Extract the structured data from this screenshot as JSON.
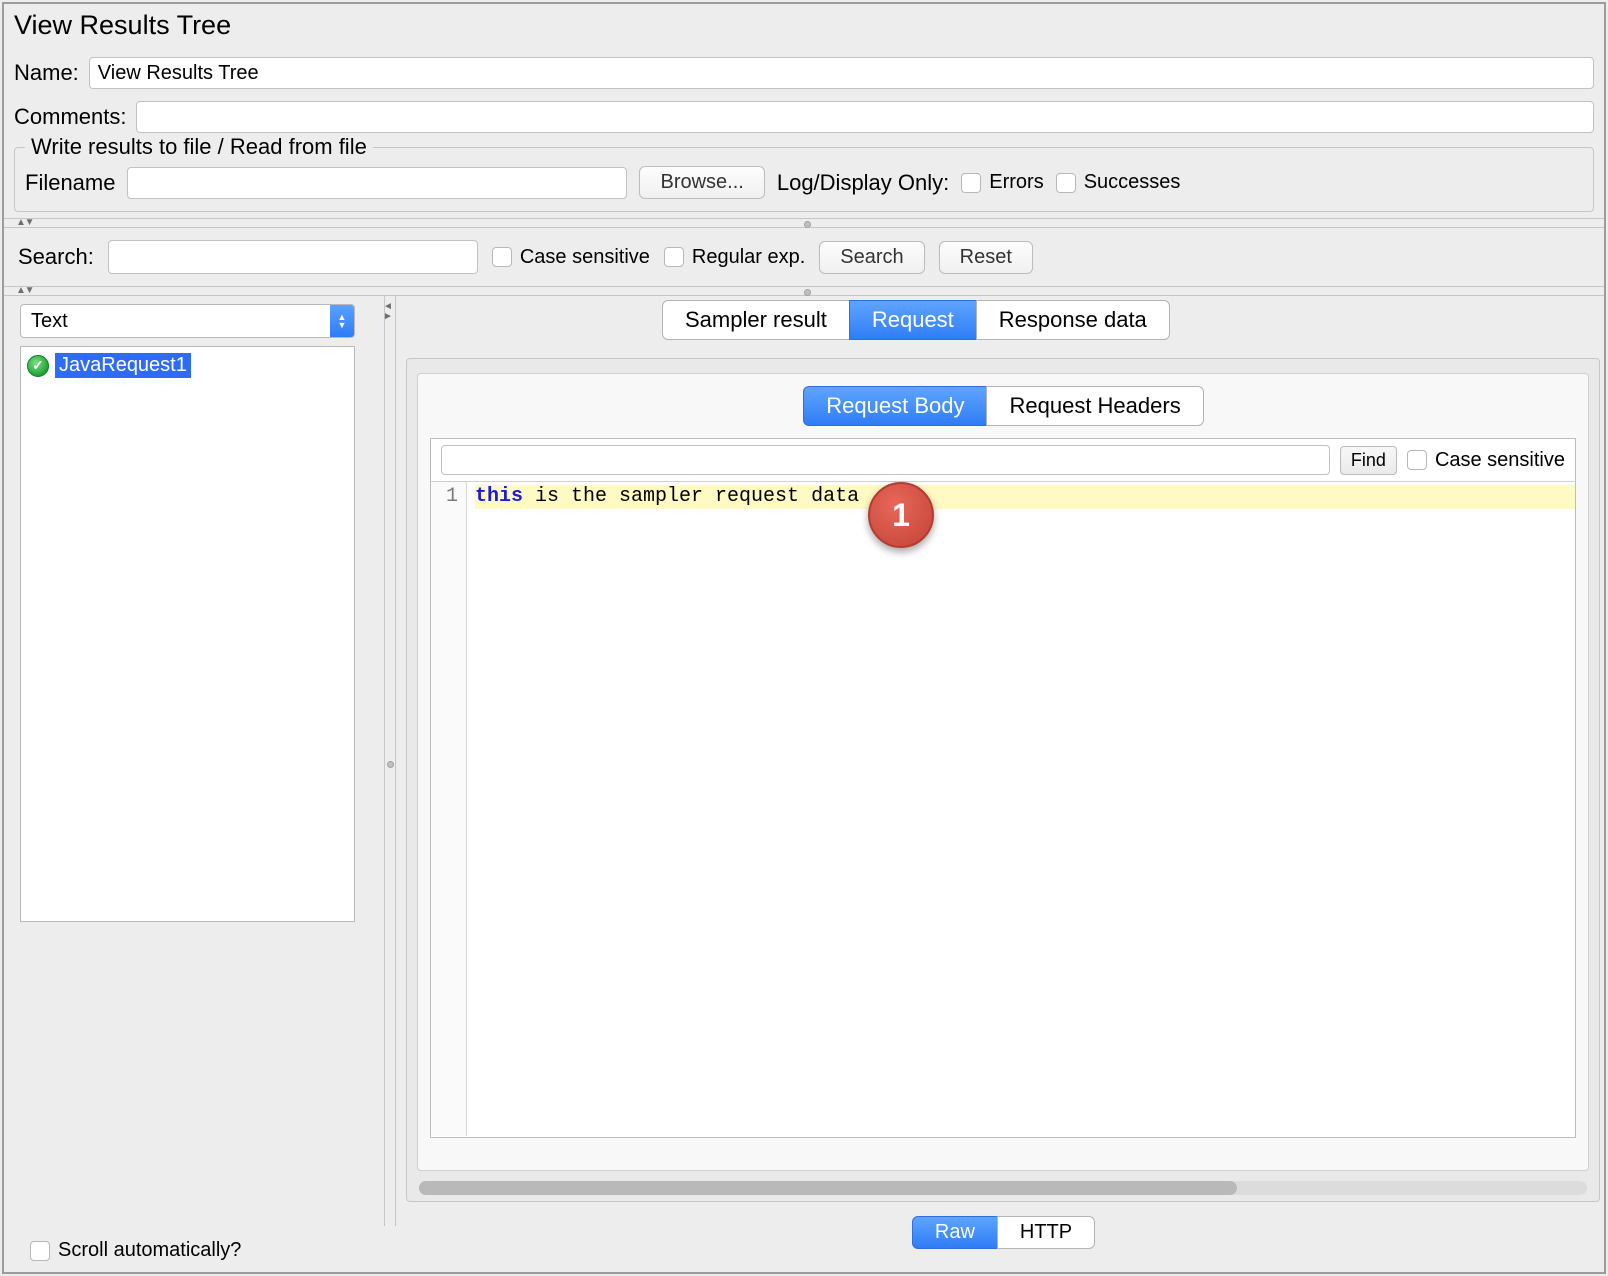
{
  "title": "View Results Tree",
  "name_label": "Name:",
  "name_value": "View Results Tree",
  "comments_label": "Comments:",
  "comments_value": "",
  "file_group": {
    "legend": "Write results to file / Read from file",
    "filename_label": "Filename",
    "filename_value": "",
    "browse_label": "Browse...",
    "logdisplay_label": "Log/Display Only:",
    "errors_label": "Errors",
    "successes_label": "Successes"
  },
  "search": {
    "label": "Search:",
    "value": "",
    "case_label": "Case sensitive",
    "regex_label": "Regular exp.",
    "search_btn": "Search",
    "reset_btn": "Reset"
  },
  "renderer": {
    "selected": "Text"
  },
  "tree": {
    "items": [
      {
        "label": "JavaRequest1",
        "status": "success",
        "selected": true
      }
    ]
  },
  "main_tabs": {
    "items": [
      "Sampler result",
      "Request",
      "Response data"
    ],
    "active_index": 1
  },
  "sub_tabs": {
    "items": [
      "Request Body",
      "Request Headers"
    ],
    "active_index": 0
  },
  "find": {
    "value": "",
    "button": "Find",
    "case_label": "Case sensitive"
  },
  "code": {
    "line_number": "1",
    "keyword": "this",
    "rest": " is the sampler  request data"
  },
  "bottom_tabs": {
    "items": [
      "Raw",
      "HTTP"
    ],
    "active_index": 0
  },
  "scroll_auto_label": "Scroll automatically?",
  "annotation_badge": "1"
}
